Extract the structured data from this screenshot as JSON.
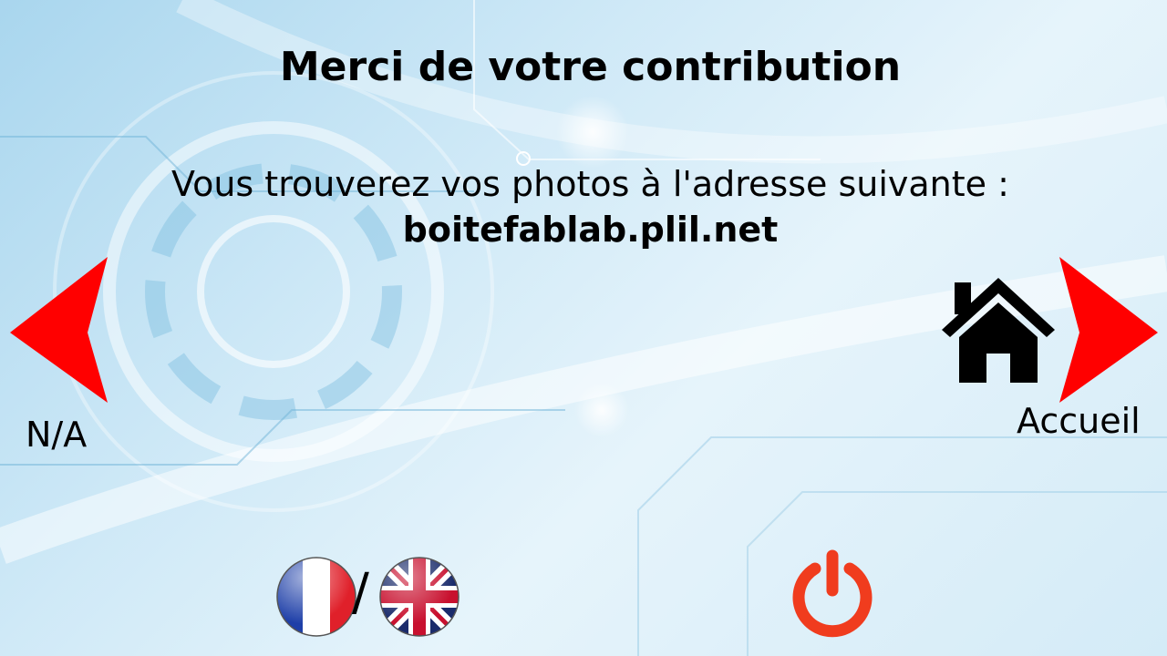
{
  "header": {
    "title": "Merci de votre contribution"
  },
  "message": {
    "line1": "Vous trouverez vos photos à l'adresse suivante :",
    "url": "boitefablab.plil.net"
  },
  "navigation": {
    "previous_label": "N/A",
    "next_label": "Accueil",
    "previous_icon": "arrow-left-icon",
    "next_icon": "arrow-right-icon",
    "home_icon": "home-icon"
  },
  "language": {
    "separator": "/",
    "options": [
      "french-flag-icon",
      "uk-flag-icon"
    ]
  },
  "power": {
    "icon": "power-icon"
  },
  "colors": {
    "arrow": "#ff0000",
    "power": "#f03c1e",
    "text": "#000000"
  }
}
